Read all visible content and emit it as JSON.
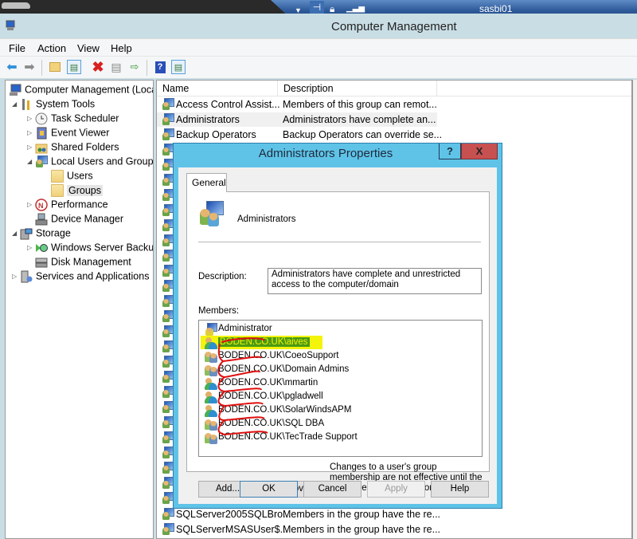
{
  "remote_bar": {
    "host": "sasbi01",
    "icons": [
      "dropdown-arrow-icon",
      "pin-icon",
      "lock-icon",
      "signal-strength-icon"
    ]
  },
  "window": {
    "title": "Computer Management"
  },
  "menu": [
    "File",
    "Action",
    "View",
    "Help"
  ],
  "toolbar": {
    "buttons": [
      "back",
      "forward",
      "up-one-level",
      "show-hide-console-tree",
      "delete",
      "properties",
      "export-list",
      "help",
      "show-hide-action-pane"
    ]
  },
  "tree": {
    "root": "Computer Management (Local",
    "items": [
      {
        "label": "System Tools"
      },
      {
        "label": "Task Scheduler"
      },
      {
        "label": "Event Viewer"
      },
      {
        "label": "Shared Folders"
      },
      {
        "label": "Local Users and Groups"
      },
      {
        "label": "Users"
      },
      {
        "label": "Groups"
      },
      {
        "label": "Performance"
      },
      {
        "label": "Device Manager"
      },
      {
        "label": "Storage"
      },
      {
        "label": "Windows Server Backup"
      },
      {
        "label": "Disk Management"
      },
      {
        "label": "Services and Applications"
      }
    ]
  },
  "list": {
    "columns": [
      "Name",
      "Description"
    ],
    "rows": [
      {
        "name": "Access Control Assist...",
        "description": "Members of this group can remot..."
      },
      {
        "name": "Administrators",
        "description": "Administrators have complete an..."
      },
      {
        "name": "Backup Operators",
        "description": "Backup Operators can override se..."
      }
    ],
    "bottom_rows": [
      {
        "name": "SQLServer2005SQLBro...",
        "description": "Members in the group have the re..."
      },
      {
        "name": "SQLServerMSASUser$...",
        "description": "Members in the group have the re..."
      }
    ]
  },
  "dialog": {
    "title": "Administrators Properties",
    "help_label": "?",
    "close_label": "X",
    "tab": "General",
    "group_name": "Administrators",
    "description_label": "Description:",
    "description": "Administrators have complete and unrestricted access to the computer/domain",
    "members_label": "Members:",
    "members": [
      {
        "name": "Administrator",
        "type": "admin"
      },
      {
        "name": "BODEN.CO.UK\\aives",
        "type": "user",
        "highlighted": true
      },
      {
        "name": "BODEN.CO.UK\\CoeoSupport",
        "type": "group"
      },
      {
        "name": "BODEN.CO.UK\\Domain Admins",
        "type": "group"
      },
      {
        "name": "BODEN.CO.UK\\mmartin",
        "type": "user"
      },
      {
        "name": "BODEN.CO.UK\\pgladwell",
        "type": "user"
      },
      {
        "name": "BODEN.CO.UK\\SolarWindsAPM",
        "type": "user"
      },
      {
        "name": "BODEN.CO.UK\\SQL DBA",
        "type": "group"
      },
      {
        "name": "BODEN.CO.UK\\TecTrade Support",
        "type": "group"
      }
    ],
    "add_label": "Add...",
    "remove_label": "Remove",
    "note": "Changes to a user's group membership are not effective until the next time the user logs on.",
    "ok_label": "OK",
    "cancel_label": "Cancel",
    "apply_label": "Apply",
    "help_button_label": "Help"
  },
  "colors": {
    "dialog_frame": "#5fc3e8",
    "close_button": "#c75050",
    "highlight_yellow": "#f4f40a",
    "highlight_green": "#4a9a14",
    "scribble_red": "#e01010"
  }
}
